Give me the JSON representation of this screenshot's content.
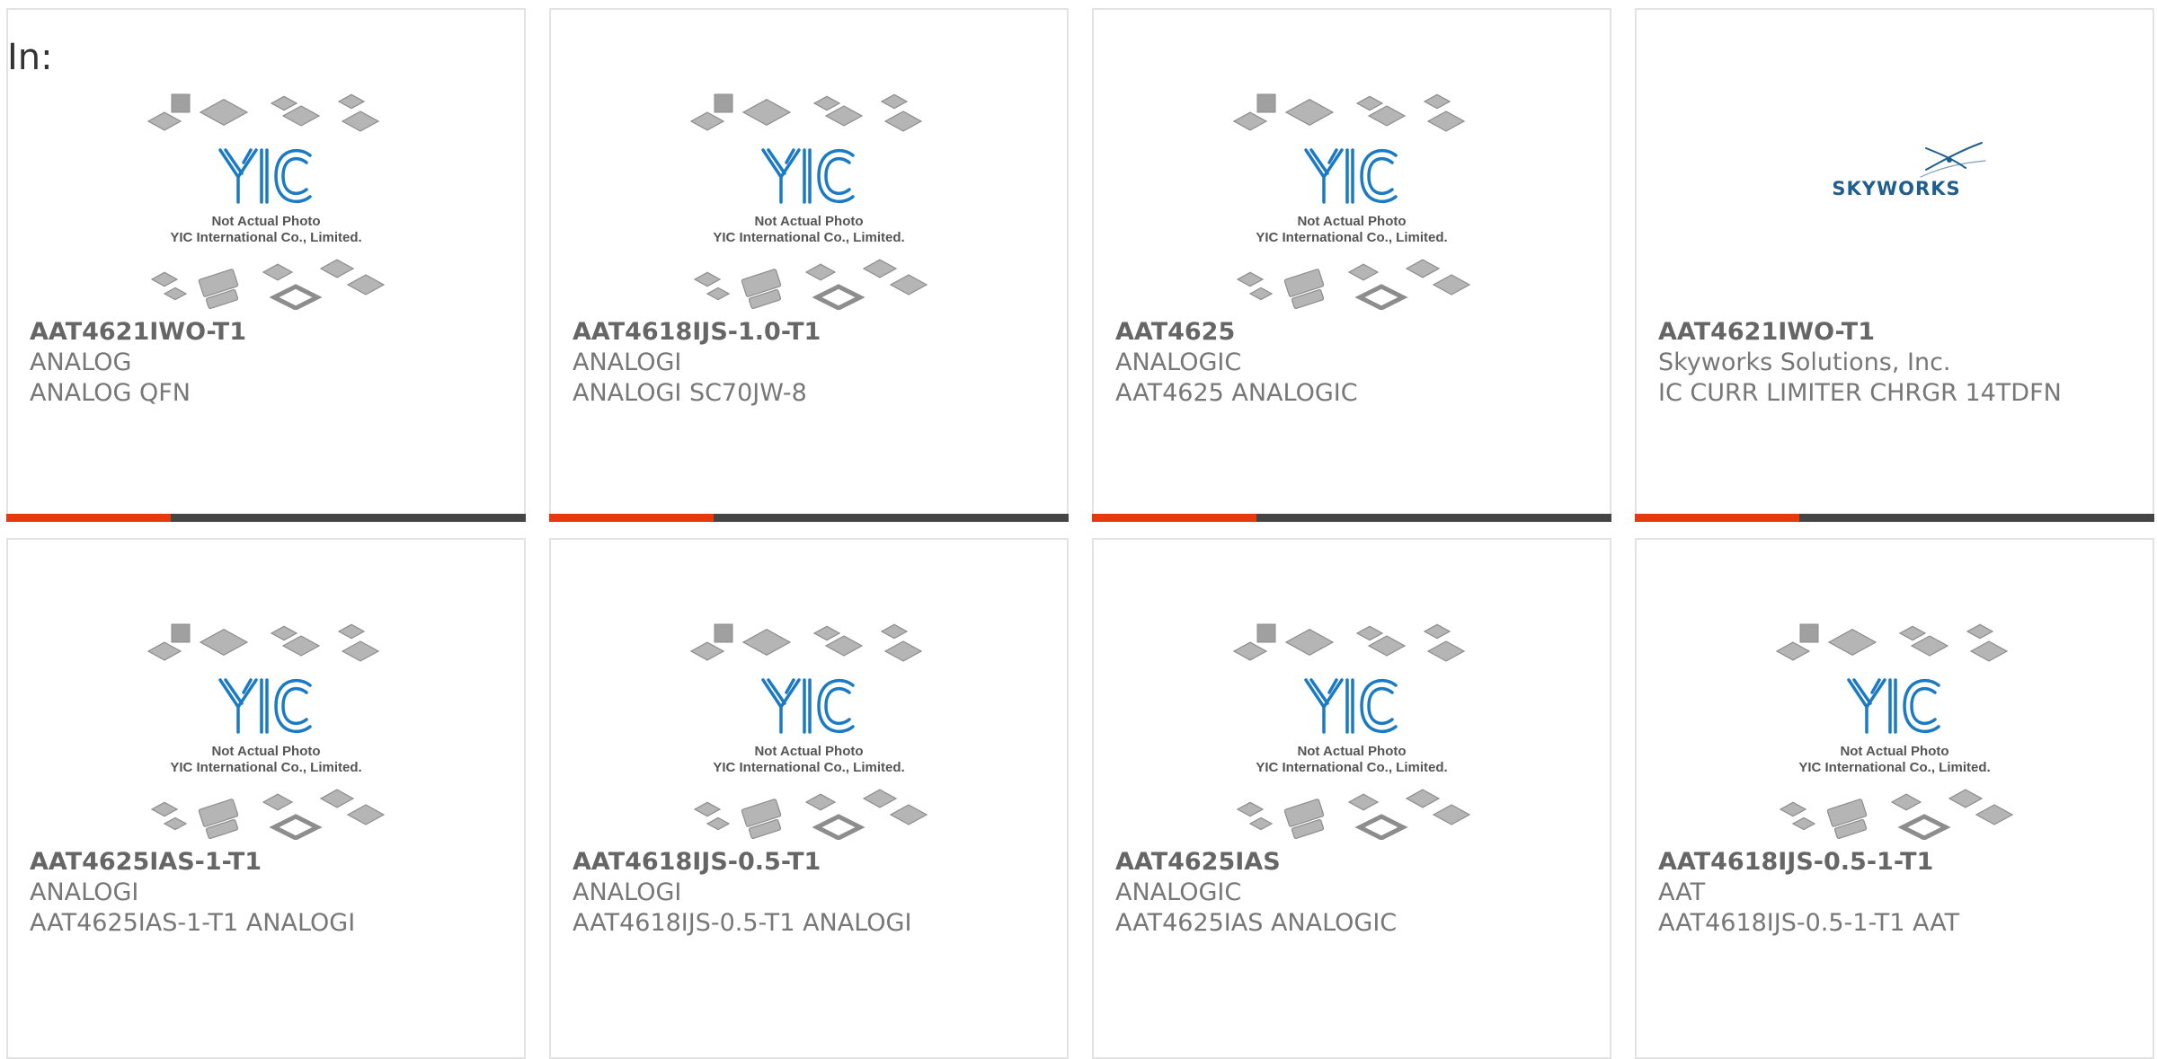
{
  "header": {
    "label": "In:"
  },
  "colors": {
    "accent": "#e8380d",
    "bar": "#454545",
    "yic_blue": "#1a7bc4",
    "skyworks_blue": "#1f5f8f"
  },
  "placeholder_image": {
    "line1": "Not Actual Photo",
    "line2": "YIC International Co., Limited."
  },
  "products": [
    {
      "part_number": "AAT4621IWO-T1",
      "manufacturer": "ANALOG",
      "description": "ANALOG QFN",
      "image": "yic-placeholder"
    },
    {
      "part_number": "AAT4618IJS-1.0-T1",
      "manufacturer": "ANALOGI",
      "description": "ANALOGI SC70JW-8",
      "image": "yic-placeholder"
    },
    {
      "part_number": "AAT4625",
      "manufacturer": "ANALOGIC",
      "description": "AAT4625 ANALOGIC",
      "image": "yic-placeholder"
    },
    {
      "part_number": "AAT4621IWO-T1",
      "manufacturer": "Skyworks Solutions, Inc.",
      "description": "IC CURR LIMITER CHRGR 14TDFN",
      "image": "skyworks-logo",
      "logo_text": "SKYWORKS"
    },
    {
      "part_number": "AAT4625IAS-1-T1",
      "manufacturer": "ANALOGI",
      "description": "AAT4625IAS-1-T1 ANALOGI",
      "image": "yic-placeholder"
    },
    {
      "part_number": "AAT4618IJS-0.5-T1",
      "manufacturer": "ANALOGI",
      "description": "AAT4618IJS-0.5-T1 ANALOGI",
      "image": "yic-placeholder"
    },
    {
      "part_number": "AAT4625IAS",
      "manufacturer": "ANALOGIC",
      "description": "AAT4625IAS ANALOGIC",
      "image": "yic-placeholder"
    },
    {
      "part_number": "AAT4618IJS-0.5-1-T1",
      "manufacturer": "AAT",
      "description": "AAT4618IJS-0.5-1-T1 AAT",
      "image": "yic-placeholder"
    }
  ]
}
